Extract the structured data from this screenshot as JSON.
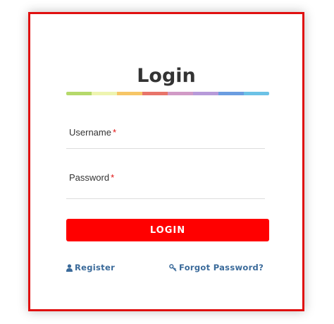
{
  "login_card": {
    "title": "Login",
    "stripe_colors": [
      "#b5d96b",
      "#eef4b0",
      "#f6c667",
      "#e8746a",
      "#d19ac6",
      "#b79ad9",
      "#6b9de0",
      "#6cc2e6"
    ],
    "username": {
      "label": "Username",
      "required_mark": "*",
      "value": ""
    },
    "password": {
      "label": "Password",
      "required_mark": "*",
      "value": ""
    },
    "login_button_label": "LOGIN",
    "register_link": {
      "label": "Register",
      "icon": "user-icon"
    },
    "forgot_link": {
      "label": "Forgot Password?",
      "icon": "key-icon"
    }
  },
  "colors": {
    "accent": "#ff0000",
    "border": "#e01010",
    "link": "#3a6a9a"
  }
}
